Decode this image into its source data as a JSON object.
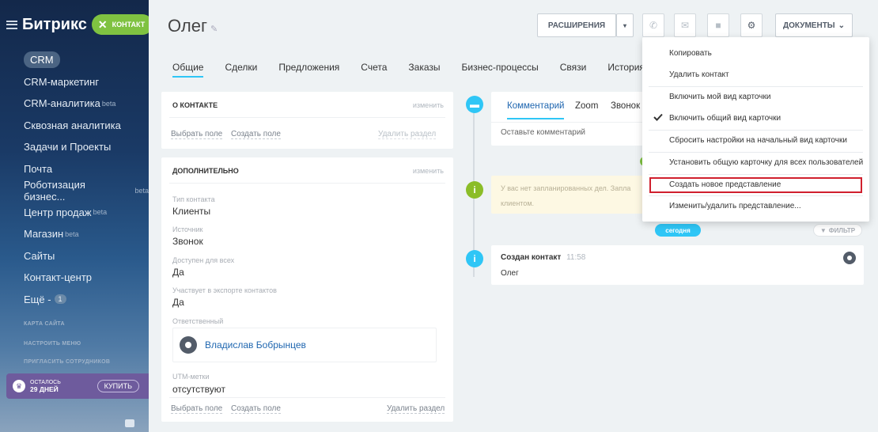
{
  "sidebar": {
    "brand": "Битрикс",
    "contact_badge": "КОНТАКТ",
    "items": [
      {
        "label": "CRM"
      },
      {
        "label": "CRM-маркетинг"
      },
      {
        "label": "CRM-аналитика",
        "sup": "beta"
      },
      {
        "label": "Сквозная аналитика"
      },
      {
        "label": "Задачи и Проекты"
      },
      {
        "label": "Почта"
      },
      {
        "label": "Роботизация бизнес...",
        "sup": "beta"
      },
      {
        "label": "Центр продаж",
        "sup": "beta"
      },
      {
        "label": "Магазин",
        "sup": "beta"
      },
      {
        "label": "Сайты"
      },
      {
        "label": "Контакт-центр"
      },
      {
        "label": "Ещё -",
        "count": "1"
      }
    ],
    "small_links": [
      "КАРТА САЙТА",
      "НАСТРОИТЬ МЕНЮ",
      "ПРИГЛАСИТЬ СОТРУДНИКОВ"
    ],
    "trial": {
      "remaining_label": "ОСТАЛОСЬ",
      "days": "29 ДНЕЙ",
      "buy_label": "КУПИТЬ"
    }
  },
  "header": {
    "title": "Олег",
    "extensions_label": "РАСШИРЕНИЯ",
    "documents_label": "ДОКУМЕНТЫ"
  },
  "tabs": [
    "Общие",
    "Сделки",
    "Предложения",
    "Счета",
    "Заказы",
    "Бизнес-процессы",
    "Связи",
    "История"
  ],
  "about_card": {
    "title": "О КОНТАКТЕ",
    "edit": "изменить",
    "select_field": "Выбрать поле",
    "create_field": "Создать поле",
    "delete_section": "Удалить раздел"
  },
  "extra_card": {
    "title": "ДОПОЛНИТЕЛЬНО",
    "edit": "изменить",
    "fields": [
      {
        "label": "Тип контакта",
        "value": "Клиенты"
      },
      {
        "label": "Источник",
        "value": "Звонок"
      },
      {
        "label": "Доступен для всех",
        "value": "Да"
      },
      {
        "label": "Участвует в экспорте контактов",
        "value": "Да"
      }
    ],
    "responsible_label": "Ответственный",
    "responsible_name": "Владислав Бобрынцев",
    "utm_label": "UTM-метки",
    "utm_value": "отсутствуют",
    "select_field": "Выбрать поле",
    "create_field": "Создать поле",
    "delete_section": "Удалить раздел"
  },
  "timeline": {
    "tabs": [
      "Комментарий",
      "Zoom",
      "Звонок"
    ],
    "comment_placeholder": "Оставьте комментарий",
    "no_plans_text": "У вас нет запланированных дел. Запла",
    "no_plans_text2": "клиентом.",
    "today": "сегодня",
    "filter": "ФИЛЬТР",
    "event_title": "Создан контакт",
    "event_time": "11:58",
    "event_body": "Олег"
  },
  "dropdown": {
    "items": [
      "Копировать",
      "Удалить контакт",
      "Включить мой вид карточки",
      "Включить общий вид карточки",
      "Сбросить настройки на начальный вид карточки",
      "Установить общую карточку для всех пользователей",
      "Создать новое представление",
      "Изменить/удалить представление..."
    ]
  },
  "colors": {
    "accent_blue": "#2fc6f6",
    "green": "#7fc241",
    "highlight_red": "#d0202e",
    "link_blue": "#2067b0"
  }
}
